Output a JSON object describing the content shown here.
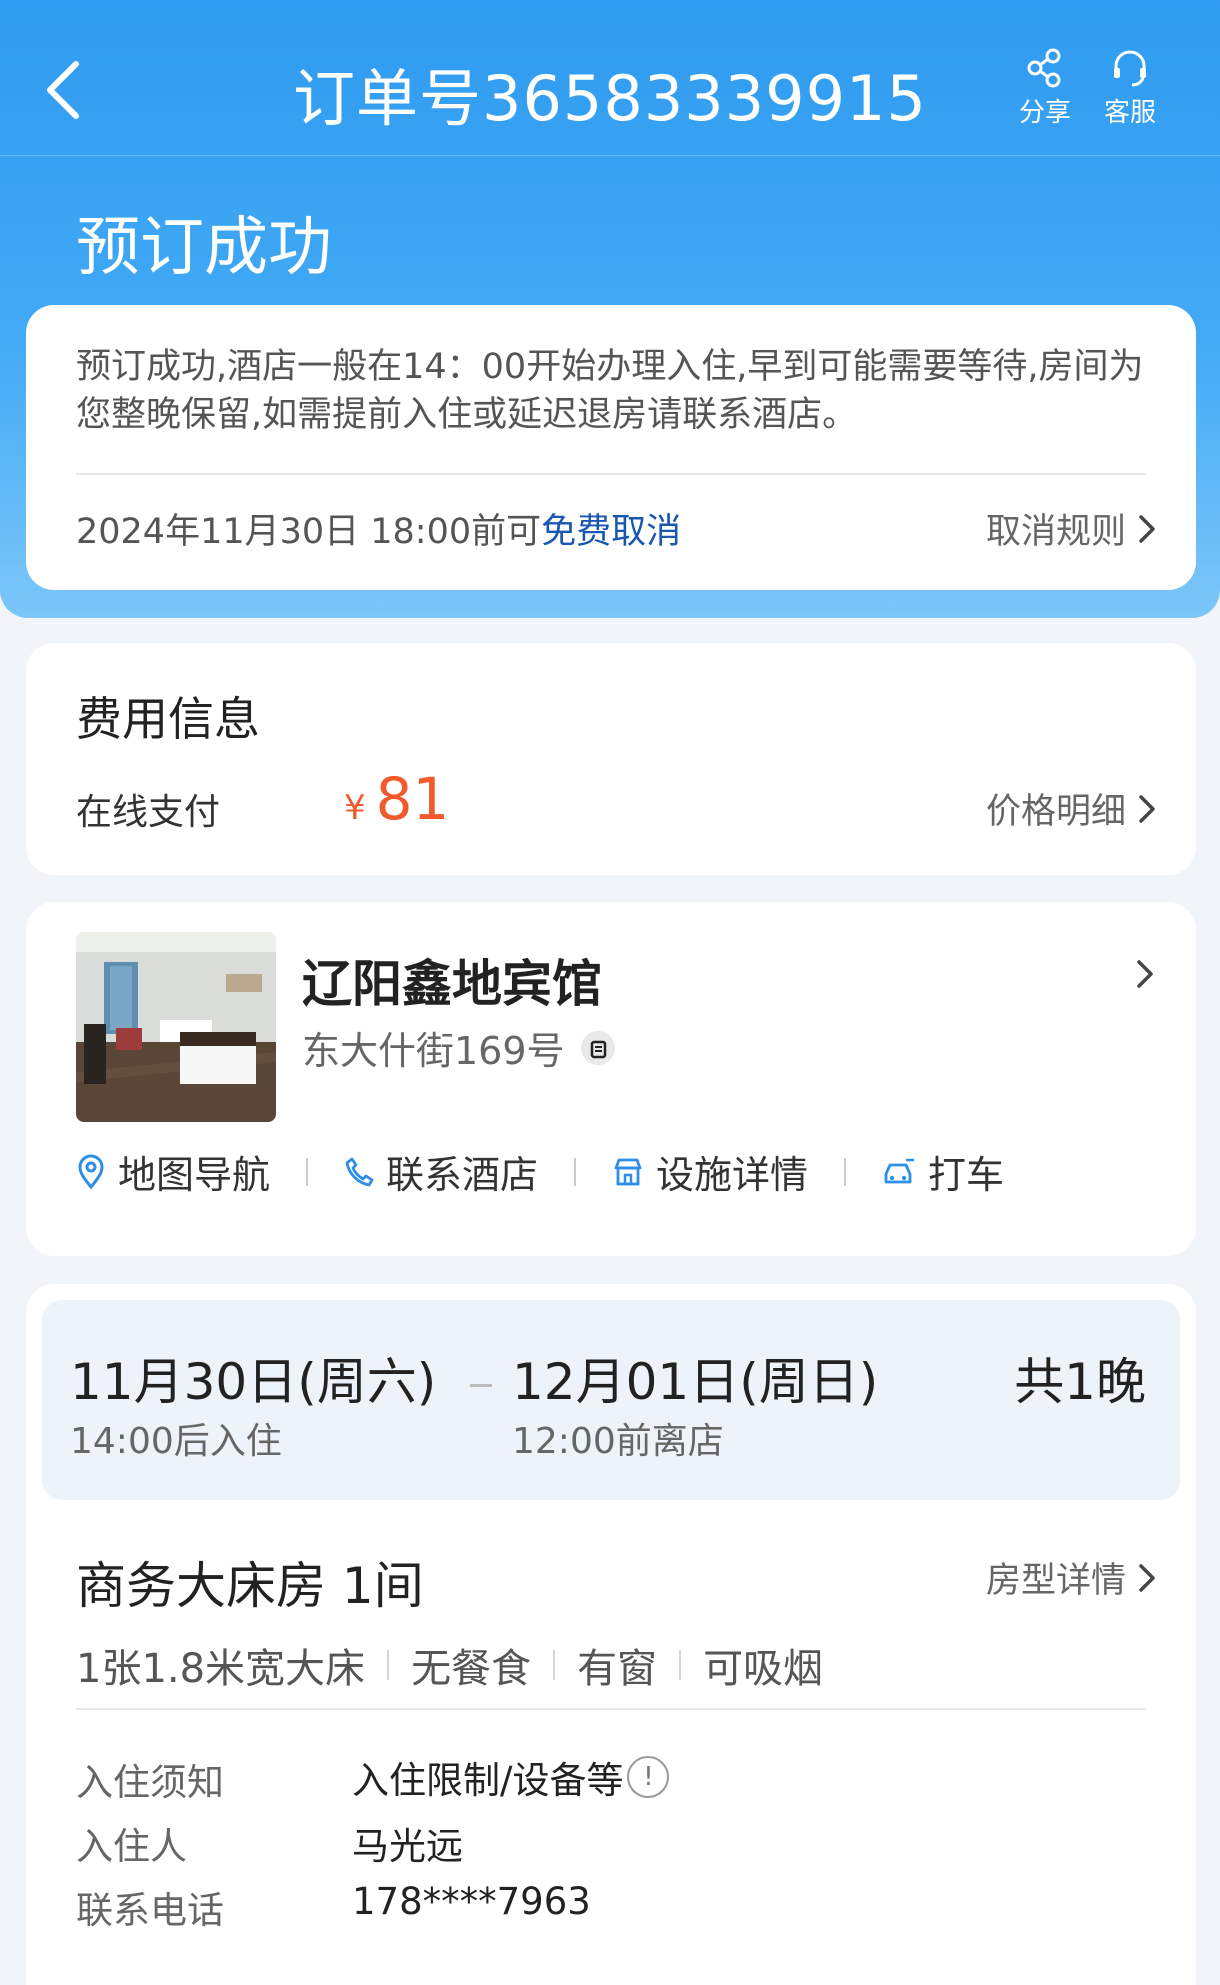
{
  "navbar": {
    "title": "订单号36583339915",
    "share_label": "分享",
    "service_label": "客服"
  },
  "status": {
    "title": "预订成功"
  },
  "notice": {
    "text": "预订成功,酒店一般在14：00开始办理入住,早到可能需要等待,房间为您整晚保留,如需提前入住或延迟退房请联系酒店。",
    "cancel_prefix": "2024年11月30日 18:00前可",
    "cancel_link": "免费取消",
    "rules_label": "取消规则"
  },
  "fee": {
    "title": "费用信息",
    "pay_label": "在线支付",
    "currency": "¥",
    "amount": "81",
    "detail_label": "价格明细"
  },
  "hotel": {
    "name": "辽阳鑫地宾馆",
    "address": "东大什街169号",
    "actions": {
      "map": "地图导航",
      "contact": "联系酒店",
      "facilities": "设施详情",
      "taxi": "打车"
    }
  },
  "stay": {
    "checkin_date": "11月30日(周六)",
    "checkin_note": "14:00后入住",
    "checkout_date": "12月01日(周日)",
    "checkout_note": "12:00前离店",
    "nights": "共1晚"
  },
  "room": {
    "name": "商务大床房 1间",
    "detail_label": "房型详情",
    "tags": [
      "1张1.8米宽大床",
      "无餐食",
      "有窗",
      "可吸烟"
    ]
  },
  "guest": {
    "notice_label": "入住须知",
    "notice_value": "入住限制/设备等",
    "guest_label": "入住人",
    "guest_value": "马光远",
    "phone_label": "联系电话",
    "phone_value": "178****7963"
  },
  "colors": {
    "header_blue": "#2f9bf0",
    "price_orange": "#f05a2c",
    "link_blue": "#1a57b0",
    "action_icon_blue": "#2f8ee8"
  }
}
